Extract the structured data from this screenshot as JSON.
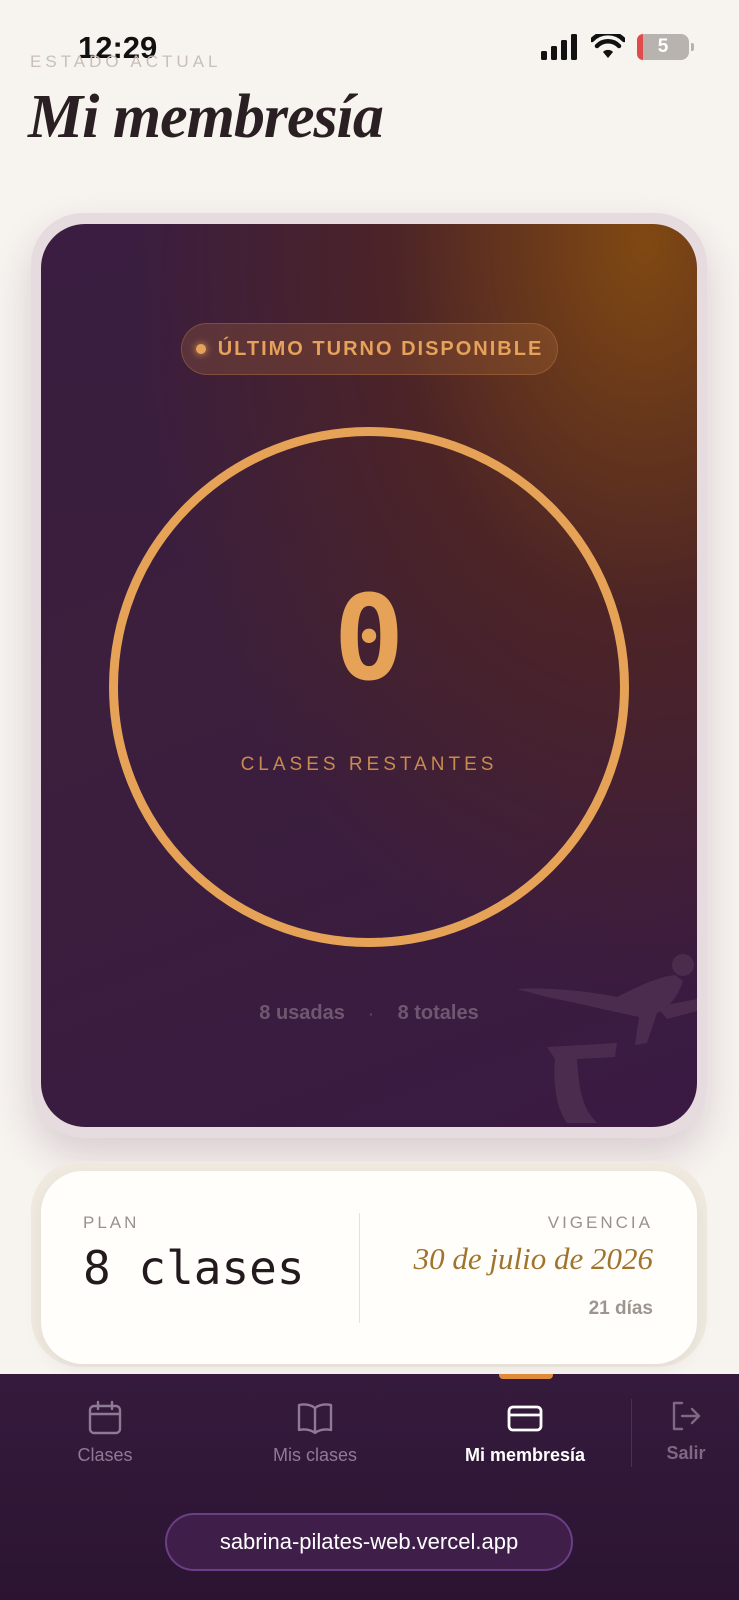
{
  "status_bar": {
    "time": "12:29",
    "battery": "5"
  },
  "header": {
    "eyebrow": "ESTADO ACTUAL",
    "title": "Mi membresía"
  },
  "membership_card": {
    "badge": "ÚLTIMO TURNO DISPONIBLE",
    "remaining": "0",
    "remaining_label": "CLASES RESTANTES",
    "used": "8 usadas",
    "separator": "·",
    "total": "8 totales",
    "ring_fraction": 1.0
  },
  "plan": {
    "label": "PLAN",
    "value": "8 clases",
    "validity_label": "VIGENCIA",
    "validity_date": "30 de julio de 2026",
    "validity_days": "21 días"
  },
  "nav": {
    "items": [
      {
        "label": "Clases",
        "icon": "calendar-icon"
      },
      {
        "label": "Mis clases",
        "icon": "book-icon"
      },
      {
        "label": "Mi membresía",
        "icon": "card-icon"
      }
    ],
    "active_index": 2,
    "logout": {
      "label": "Salir",
      "icon": "logout-icon"
    }
  },
  "browser": {
    "url": "sabrina-pilates-web.vercel.app"
  },
  "colors": {
    "accent": "#e6a357",
    "card_bg": "#3a1d40",
    "nav_bg": "#2b1432",
    "active_indicator": "#e08a3c"
  }
}
